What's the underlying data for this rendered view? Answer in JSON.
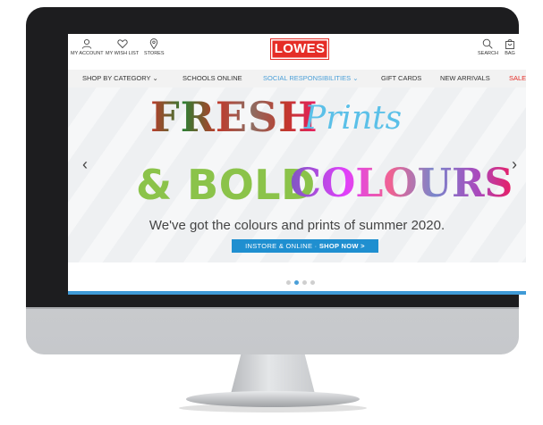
{
  "header": {
    "utility_left": [
      {
        "label": "MY ACCOUNT",
        "icon": "user-icon"
      },
      {
        "label": "MY WISH LIST",
        "icon": "heart-icon"
      },
      {
        "label": "STORES",
        "icon": "location-pin-icon"
      }
    ],
    "logo_text": "LOWES",
    "utility_right": [
      {
        "label": "SEARCH",
        "icon": "search-icon"
      },
      {
        "label": "BAG",
        "icon": "bag-icon"
      }
    ]
  },
  "nav": {
    "items": [
      {
        "label": "SHOP BY CATEGORY",
        "has_dropdown": true
      },
      {
        "label": "SCHOOLS ONLINE"
      },
      {
        "label": "SOCIAL RESPONSIBILITIES",
        "has_dropdown": true,
        "highlight": "blue"
      },
      {
        "label": "GIFT CARDS"
      },
      {
        "label": "NEW ARRIVALS"
      },
      {
        "label": "SALE",
        "highlight": "red"
      }
    ]
  },
  "hero": {
    "line1_word1": "FRESH",
    "line1_word2": "Prints",
    "line2_word1": "& BOLD",
    "line2_word2": "COLOURS",
    "tagline": "We've got the colours and prints of summer 2020.",
    "cta_prefix": "INSTORE & ONLINE · ",
    "cta_action": "SHOP NOW >",
    "prev_arrow": "‹",
    "next_arrow": "›"
  },
  "carousel": {
    "slide_count": 4,
    "active_index": 1
  },
  "colors": {
    "brand_red": "#e52d27",
    "accent_blue": "#1f8fd0",
    "nav_blue": "#4a9fd8",
    "sale_red": "#e52d27"
  }
}
